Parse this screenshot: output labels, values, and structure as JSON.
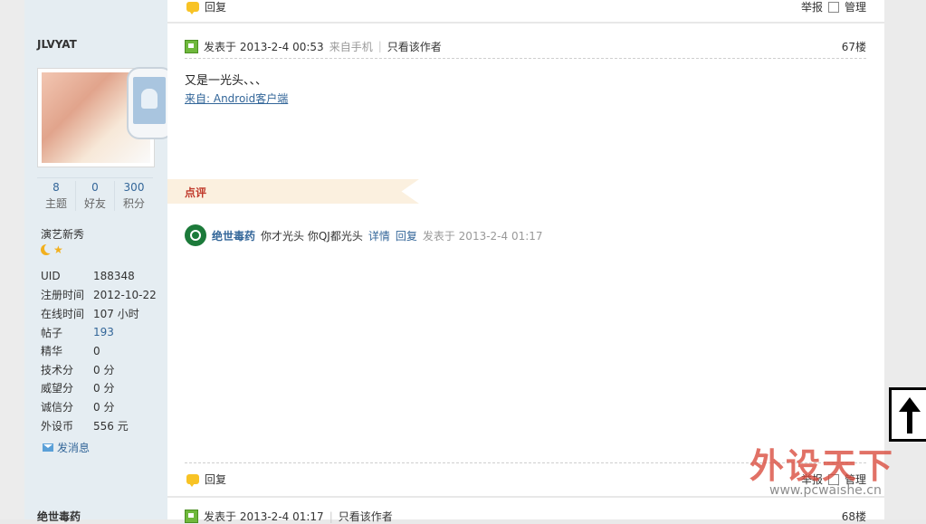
{
  "top": {
    "reply_label": "回复",
    "report_label": "举报",
    "manage_label": "管理"
  },
  "user": {
    "username": "JLVYAT",
    "stats": [
      {
        "value": "8",
        "label": "主题"
      },
      {
        "value": "0",
        "label": "好友"
      },
      {
        "value": "300",
        "label": "积分"
      }
    ],
    "rank": "演艺新秀",
    "info": [
      {
        "key": "UID",
        "value": "188348",
        "link": false
      },
      {
        "key": "注册时间",
        "value": "2012-10-22",
        "link": false
      },
      {
        "key": "在线时间",
        "value": "107 小时",
        "link": false
      },
      {
        "key": "帖子",
        "value": "193",
        "link": true
      },
      {
        "key": "精华",
        "value": "0",
        "link": false
      },
      {
        "key": "技术分",
        "value": "0 分",
        "link": false
      },
      {
        "key": "威望分",
        "value": "0 分",
        "link": false
      },
      {
        "key": "诚信分",
        "value": "0 分",
        "link": false
      },
      {
        "key": "外设币",
        "value": "556 元",
        "link": false
      }
    ],
    "send_message": "发消息"
  },
  "post": {
    "posted_at": "发表于 2013-2-4 00:53",
    "from_mobile": "来自手机",
    "only_author": "只看该作者",
    "floor": "67楼",
    "text": "又是一光头、、、",
    "source": "来自: Android客户端"
  },
  "rating": {
    "label": "点评"
  },
  "comment": {
    "author": "绝世毒药",
    "text": "你才光头 你QJ都光头",
    "detail": "详情",
    "reply": "回复",
    "time": "发表于 2013-2-4 01:17"
  },
  "bottom": {
    "reply_label": "回复",
    "report_label": "举报",
    "manage_label": "管理"
  },
  "next_post": {
    "username": "绝世毒药",
    "posted_at": "发表于 2013-2-4 01:17",
    "only_author": "只看该作者",
    "floor": "68楼"
  },
  "watermark": {
    "title": "外设天下",
    "url": "www.pcwaishe.cn"
  }
}
